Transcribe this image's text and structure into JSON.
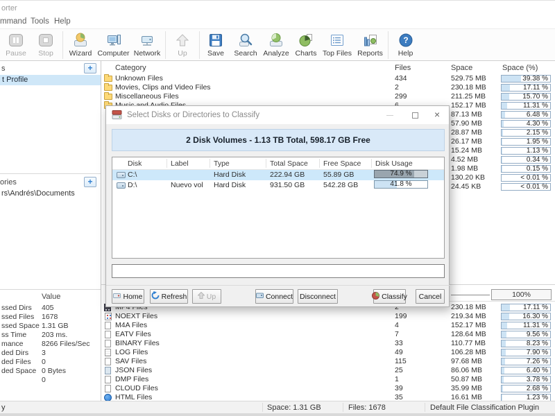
{
  "window": {
    "title": "orter",
    "menu": {
      "command": "mmand",
      "tools": "Tools",
      "help": "Help"
    }
  },
  "toolbar": {
    "pause": "Pause",
    "stop": "Stop",
    "wizard": "Wizard",
    "computer": "Computer",
    "network": "Network",
    "up": "Up",
    "save": "Save",
    "search": "Search",
    "analyze": "Analyze",
    "charts": "Charts",
    "top_files": "Top Files",
    "reports": "Reports",
    "help": "Help"
  },
  "sidebar": {
    "profiles": {
      "header": "s",
      "selected_item": "t Profile"
    },
    "directories": {
      "header": "ories",
      "item": "rs\\Andrés\\Documents"
    },
    "stats": {
      "value_header": "Value",
      "rows": [
        [
          "ssed Dirs",
          "405"
        ],
        [
          "ssed Files",
          "1678"
        ],
        [
          "ssed Space",
          "1.31 GB"
        ],
        [
          "ss Time",
          "203 ms."
        ],
        [
          "mance",
          "8266 Files/Sec"
        ],
        [
          "ded Dirs",
          "3"
        ],
        [
          "ded Files",
          "0"
        ],
        [
          "ded Space",
          "0 Bytes"
        ],
        [
          "",
          "0"
        ]
      ]
    }
  },
  "top_table": {
    "headers": {
      "category": "Category",
      "files": "Files",
      "space": "Space",
      "pct": "Space (%)"
    },
    "rows": [
      {
        "icon": "fi-folder",
        "category": "Unknown Files",
        "files": "434",
        "space": "529.75 MB",
        "pct": 39.38,
        "pct_label": "39.38 %"
      },
      {
        "icon": "fi-folder",
        "category": "Movies, Clips and Video Files",
        "files": "2",
        "space": "230.18 MB",
        "pct": 17.11,
        "pct_label": "17.11 %"
      },
      {
        "icon": "fi-folder",
        "category": "Miscellaneous Files",
        "files": "299",
        "space": "211.25 MB",
        "pct": 15.7,
        "pct_label": "15.70 %"
      },
      {
        "icon": "fi-folder",
        "category": "Music and Audio Files",
        "files": "6",
        "space": "152.17 MB",
        "pct": 11.31,
        "pct_label": "11.31 %"
      },
      {
        "icon": "fi-none",
        "category": "",
        "files": "",
        "space": "87.13 MB",
        "pct": 6.48,
        "pct_label": "6.48 %"
      },
      {
        "icon": "fi-none",
        "category": "",
        "files": "",
        "space": "57.90 MB",
        "pct": 4.3,
        "pct_label": "4.30 %"
      },
      {
        "icon": "fi-none",
        "category": "",
        "files": "",
        "space": "28.87 MB",
        "pct": 2.15,
        "pct_label": "2.15 %"
      },
      {
        "icon": "fi-none",
        "category": "",
        "files": "",
        "space": "26.17 MB",
        "pct": 1.95,
        "pct_label": "1.95 %"
      },
      {
        "icon": "fi-none",
        "category": "",
        "files": "",
        "space": "15.24 MB",
        "pct": 1.13,
        "pct_label": "1.13 %"
      },
      {
        "icon": "fi-none",
        "category": "",
        "files": "",
        "space": "4.52 MB",
        "pct": 0.34,
        "pct_label": "0.34 %"
      },
      {
        "icon": "fi-none",
        "category": "",
        "files": "",
        "space": "1.98 MB",
        "pct": 0.15,
        "pct_label": "0.15 %"
      },
      {
        "icon": "fi-none",
        "category": "",
        "files": "",
        "space": "130.20 KB",
        "pct": 0,
        "pct_label": "< 0.01 %"
      },
      {
        "icon": "fi-none",
        "category": "",
        "files": "",
        "space": "24.45 KB",
        "pct": 0,
        "pct_label": "< 0.01 %"
      }
    ]
  },
  "bottom_table": {
    "scale": "100%",
    "rows": [
      {
        "icon": "fi-film",
        "category": "MP4 Files",
        "files": "2",
        "space": "230.18 MB",
        "pct": 17.11,
        "pct_label": "17.11 %"
      },
      {
        "icon": "fi-noext",
        "category": "NOEXT Files",
        "files": "199",
        "space": "219.34 MB",
        "pct": 16.3,
        "pct_label": "16.30 %"
      },
      {
        "icon": "fi-page",
        "category": "M4A Files",
        "files": "4",
        "space": "152.17 MB",
        "pct": 11.31,
        "pct_label": "11.31 %"
      },
      {
        "icon": "fi-page",
        "category": "EATV Files",
        "files": "7",
        "space": "128.64 MB",
        "pct": 9.56,
        "pct_label": "9.56 %"
      },
      {
        "icon": "fi-page",
        "category": "BINARY Files",
        "files": "33",
        "space": "110.77 MB",
        "pct": 8.23,
        "pct_label": "8.23 %"
      },
      {
        "icon": "fi-log",
        "category": "LOG Files",
        "files": "49",
        "space": "106.28 MB",
        "pct": 7.9,
        "pct_label": "7.90 %"
      },
      {
        "icon": "fi-page",
        "category": "SAV Files",
        "files": "115",
        "space": "97.68 MB",
        "pct": 7.26,
        "pct_label": "7.26 %"
      },
      {
        "icon": "fi-json",
        "category": "JSON Files",
        "files": "25",
        "space": "86.06 MB",
        "pct": 6.4,
        "pct_label": "6.40 %"
      },
      {
        "icon": "fi-page",
        "category": "DMP Files",
        "files": "1",
        "space": "50.87 MB",
        "pct": 3.78,
        "pct_label": "3.78 %"
      },
      {
        "icon": "fi-page",
        "category": "CLOUD Files",
        "files": "39",
        "space": "35.99 MB",
        "pct": 2.68,
        "pct_label": "2.68 %"
      },
      {
        "icon": "fi-html",
        "category": "HTML Files",
        "files": "35",
        "space": "16.61 MB",
        "pct": 1.23,
        "pct_label": "1.23 %"
      }
    ]
  },
  "dialog": {
    "title": "Select Disks or Directories to Classify",
    "banner": "2 Disk Volumes - 1.13 TB Total, 598.17 GB Free",
    "table": {
      "headers": {
        "disk": "Disk",
        "label": "Label",
        "type": "Type",
        "total": "Total Space",
        "free": "Free Space",
        "usage": "Disk Usage"
      },
      "rows": [
        {
          "row_class": "sel",
          "disk": "C:\\",
          "label": "",
          "type": "Hard Disk",
          "total": "222.94 GB",
          "free": "55.89 GB",
          "usage": 74.9,
          "usage_label": "74.9 %"
        },
        {
          "row_class": "",
          "disk": "D:\\",
          "label": "Nuevo vol",
          "type": "Hard Disk",
          "total": "931.50 GB",
          "free": "542.28 GB",
          "usage": 41.8,
          "usage_label": "41.8 %"
        }
      ]
    },
    "path_input": "",
    "buttons": {
      "home": "Home",
      "refresh": "Refresh",
      "up": "Up",
      "connect": "Connect",
      "disconnect": "Disconnect",
      "classify": "Classify",
      "cancel": "Cancel"
    }
  },
  "statusbar": {
    "left": "y",
    "space": "Space: 1.31 GB",
    "files": "Files: 1678",
    "plugin": "Default File Classification Plugin"
  }
}
